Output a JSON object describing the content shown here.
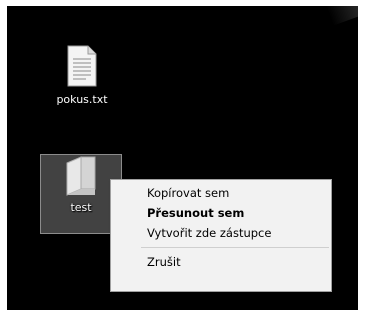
{
  "desktop": {
    "icons": [
      {
        "label": "pokus.txt",
        "icon": "text-file-icon"
      },
      {
        "label": "test",
        "icon": "folder-icon",
        "selected": true
      }
    ]
  },
  "context_menu": {
    "items": [
      {
        "label": "Kopírovat sem",
        "bold": false
      },
      {
        "label": "Přesunout sem",
        "bold": true
      },
      {
        "label": "Vytvořit zde zástupce",
        "bold": false
      }
    ],
    "cancel_label": "Zrušit"
  },
  "colors": {
    "desktop_background": "#000000",
    "menu_background": "#f2f2f2",
    "selection_highlight": "#787878"
  }
}
